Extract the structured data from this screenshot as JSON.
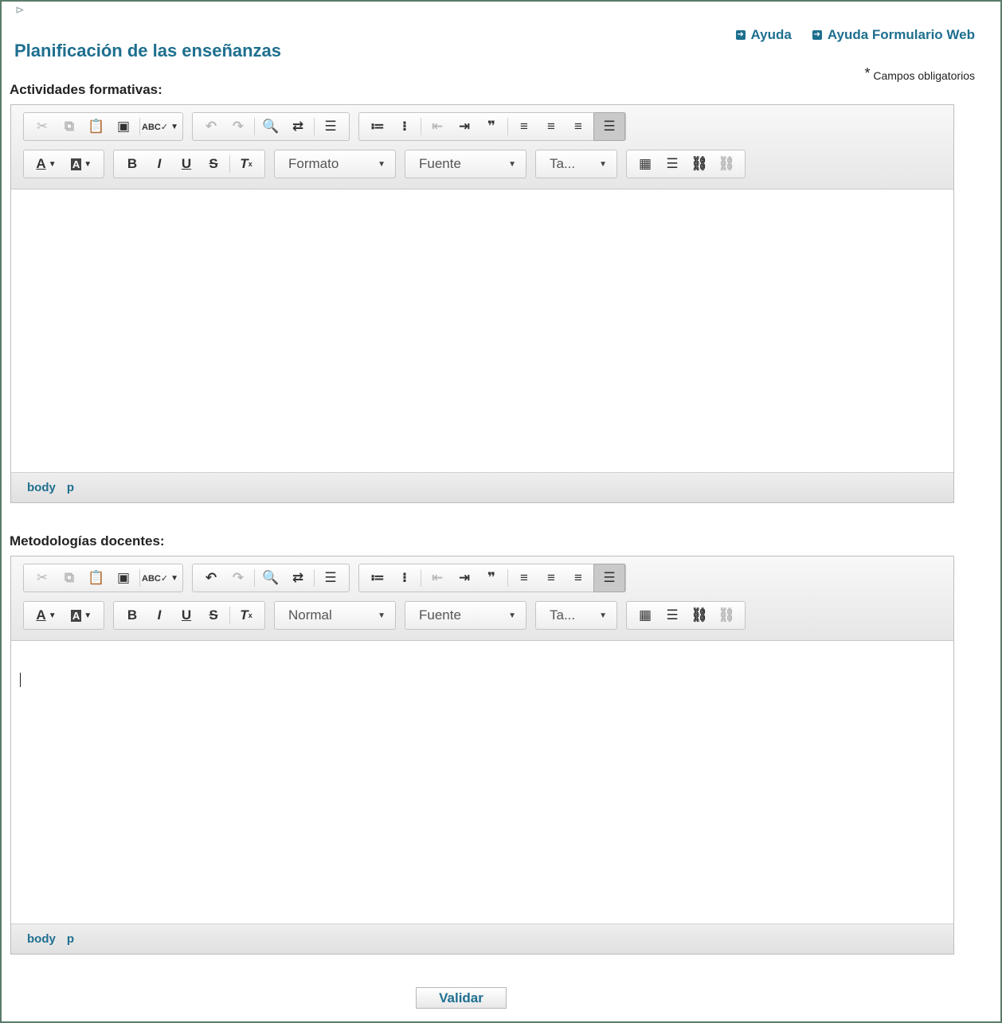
{
  "header": {
    "title": "Planificación de las enseñanzas",
    "help_link": "Ayuda",
    "help_form_link": "Ayuda Formulario Web",
    "required_star": "*",
    "required_note": "Campos obligatorios"
  },
  "editor_common": {
    "font_label": "Fuente",
    "size_label": "Ta...",
    "path": [
      "body",
      "p"
    ]
  },
  "fields": [
    {
      "label": "Actividades formativas:",
      "format_value": "Formato",
      "content": ""
    },
    {
      "label": "Metodologías docentes:",
      "format_value": "Normal",
      "content": ""
    }
  ],
  "submit_label": "Validar",
  "colors": {
    "accent": "#1e6f8f",
    "frame_border": "#5b7b6a"
  }
}
